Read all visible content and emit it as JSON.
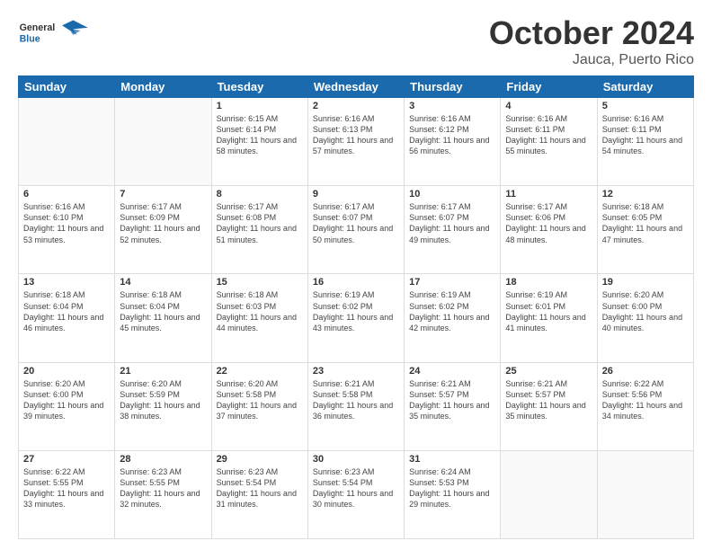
{
  "header": {
    "month_title": "October 2024",
    "subtitle": "Jauca, Puerto Rico",
    "logo_general": "General",
    "logo_blue": "Blue"
  },
  "days_of_week": [
    "Sunday",
    "Monday",
    "Tuesday",
    "Wednesday",
    "Thursday",
    "Friday",
    "Saturday"
  ],
  "weeks": [
    [
      {
        "day": "",
        "sunrise": "",
        "sunset": "",
        "daylight": ""
      },
      {
        "day": "",
        "sunrise": "",
        "sunset": "",
        "daylight": ""
      },
      {
        "day": "1",
        "sunrise": "Sunrise: 6:15 AM",
        "sunset": "Sunset: 6:14 PM",
        "daylight": "Daylight: 11 hours and 58 minutes."
      },
      {
        "day": "2",
        "sunrise": "Sunrise: 6:16 AM",
        "sunset": "Sunset: 6:13 PM",
        "daylight": "Daylight: 11 hours and 57 minutes."
      },
      {
        "day": "3",
        "sunrise": "Sunrise: 6:16 AM",
        "sunset": "Sunset: 6:12 PM",
        "daylight": "Daylight: 11 hours and 56 minutes."
      },
      {
        "day": "4",
        "sunrise": "Sunrise: 6:16 AM",
        "sunset": "Sunset: 6:11 PM",
        "daylight": "Daylight: 11 hours and 55 minutes."
      },
      {
        "day": "5",
        "sunrise": "Sunrise: 6:16 AM",
        "sunset": "Sunset: 6:11 PM",
        "daylight": "Daylight: 11 hours and 54 minutes."
      }
    ],
    [
      {
        "day": "6",
        "sunrise": "Sunrise: 6:16 AM",
        "sunset": "Sunset: 6:10 PM",
        "daylight": "Daylight: 11 hours and 53 minutes."
      },
      {
        "day": "7",
        "sunrise": "Sunrise: 6:17 AM",
        "sunset": "Sunset: 6:09 PM",
        "daylight": "Daylight: 11 hours and 52 minutes."
      },
      {
        "day": "8",
        "sunrise": "Sunrise: 6:17 AM",
        "sunset": "Sunset: 6:08 PM",
        "daylight": "Daylight: 11 hours and 51 minutes."
      },
      {
        "day": "9",
        "sunrise": "Sunrise: 6:17 AM",
        "sunset": "Sunset: 6:07 PM",
        "daylight": "Daylight: 11 hours and 50 minutes."
      },
      {
        "day": "10",
        "sunrise": "Sunrise: 6:17 AM",
        "sunset": "Sunset: 6:07 PM",
        "daylight": "Daylight: 11 hours and 49 minutes."
      },
      {
        "day": "11",
        "sunrise": "Sunrise: 6:17 AM",
        "sunset": "Sunset: 6:06 PM",
        "daylight": "Daylight: 11 hours and 48 minutes."
      },
      {
        "day": "12",
        "sunrise": "Sunrise: 6:18 AM",
        "sunset": "Sunset: 6:05 PM",
        "daylight": "Daylight: 11 hours and 47 minutes."
      }
    ],
    [
      {
        "day": "13",
        "sunrise": "Sunrise: 6:18 AM",
        "sunset": "Sunset: 6:04 PM",
        "daylight": "Daylight: 11 hours and 46 minutes."
      },
      {
        "day": "14",
        "sunrise": "Sunrise: 6:18 AM",
        "sunset": "Sunset: 6:04 PM",
        "daylight": "Daylight: 11 hours and 45 minutes."
      },
      {
        "day": "15",
        "sunrise": "Sunrise: 6:18 AM",
        "sunset": "Sunset: 6:03 PM",
        "daylight": "Daylight: 11 hours and 44 minutes."
      },
      {
        "day": "16",
        "sunrise": "Sunrise: 6:19 AM",
        "sunset": "Sunset: 6:02 PM",
        "daylight": "Daylight: 11 hours and 43 minutes."
      },
      {
        "day": "17",
        "sunrise": "Sunrise: 6:19 AM",
        "sunset": "Sunset: 6:02 PM",
        "daylight": "Daylight: 11 hours and 42 minutes."
      },
      {
        "day": "18",
        "sunrise": "Sunrise: 6:19 AM",
        "sunset": "Sunset: 6:01 PM",
        "daylight": "Daylight: 11 hours and 41 minutes."
      },
      {
        "day": "19",
        "sunrise": "Sunrise: 6:20 AM",
        "sunset": "Sunset: 6:00 PM",
        "daylight": "Daylight: 11 hours and 40 minutes."
      }
    ],
    [
      {
        "day": "20",
        "sunrise": "Sunrise: 6:20 AM",
        "sunset": "Sunset: 6:00 PM",
        "daylight": "Daylight: 11 hours and 39 minutes."
      },
      {
        "day": "21",
        "sunrise": "Sunrise: 6:20 AM",
        "sunset": "Sunset: 5:59 PM",
        "daylight": "Daylight: 11 hours and 38 minutes."
      },
      {
        "day": "22",
        "sunrise": "Sunrise: 6:20 AM",
        "sunset": "Sunset: 5:58 PM",
        "daylight": "Daylight: 11 hours and 37 minutes."
      },
      {
        "day": "23",
        "sunrise": "Sunrise: 6:21 AM",
        "sunset": "Sunset: 5:58 PM",
        "daylight": "Daylight: 11 hours and 36 minutes."
      },
      {
        "day": "24",
        "sunrise": "Sunrise: 6:21 AM",
        "sunset": "Sunset: 5:57 PM",
        "daylight": "Daylight: 11 hours and 35 minutes."
      },
      {
        "day": "25",
        "sunrise": "Sunrise: 6:21 AM",
        "sunset": "Sunset: 5:57 PM",
        "daylight": "Daylight: 11 hours and 35 minutes."
      },
      {
        "day": "26",
        "sunrise": "Sunrise: 6:22 AM",
        "sunset": "Sunset: 5:56 PM",
        "daylight": "Daylight: 11 hours and 34 minutes."
      }
    ],
    [
      {
        "day": "27",
        "sunrise": "Sunrise: 6:22 AM",
        "sunset": "Sunset: 5:55 PM",
        "daylight": "Daylight: 11 hours and 33 minutes."
      },
      {
        "day": "28",
        "sunrise": "Sunrise: 6:23 AM",
        "sunset": "Sunset: 5:55 PM",
        "daylight": "Daylight: 11 hours and 32 minutes."
      },
      {
        "day": "29",
        "sunrise": "Sunrise: 6:23 AM",
        "sunset": "Sunset: 5:54 PM",
        "daylight": "Daylight: 11 hours and 31 minutes."
      },
      {
        "day": "30",
        "sunrise": "Sunrise: 6:23 AM",
        "sunset": "Sunset: 5:54 PM",
        "daylight": "Daylight: 11 hours and 30 minutes."
      },
      {
        "day": "31",
        "sunrise": "Sunrise: 6:24 AM",
        "sunset": "Sunset: 5:53 PM",
        "daylight": "Daylight: 11 hours and 29 minutes."
      },
      {
        "day": "",
        "sunrise": "",
        "sunset": "",
        "daylight": ""
      },
      {
        "day": "",
        "sunrise": "",
        "sunset": "",
        "daylight": ""
      }
    ]
  ]
}
